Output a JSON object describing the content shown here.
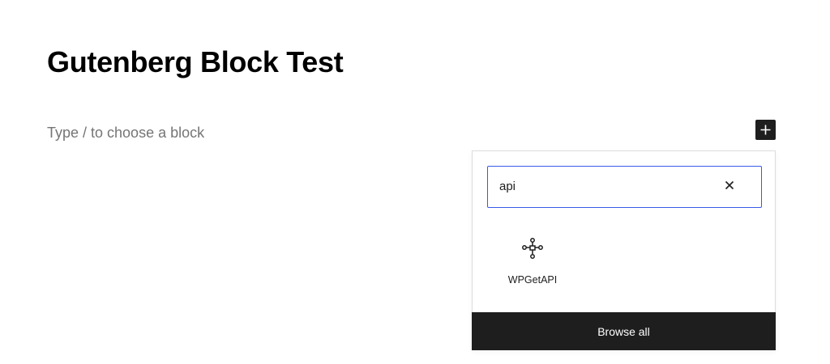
{
  "editor": {
    "post_title": "Gutenberg Block Test",
    "block_placeholder": "Type / to choose a block"
  },
  "inserter": {
    "toggle_icon": "plus-icon",
    "search": {
      "value": "api",
      "clear_icon": "close-icon"
    },
    "results": [
      {
        "label": "WPGetAPI",
        "icon": "api-connection-icon"
      }
    ],
    "browse_all_label": "Browse all"
  },
  "colors": {
    "accent": "#3858e9",
    "dark": "#1e1e1e",
    "placeholder": "#757575"
  }
}
